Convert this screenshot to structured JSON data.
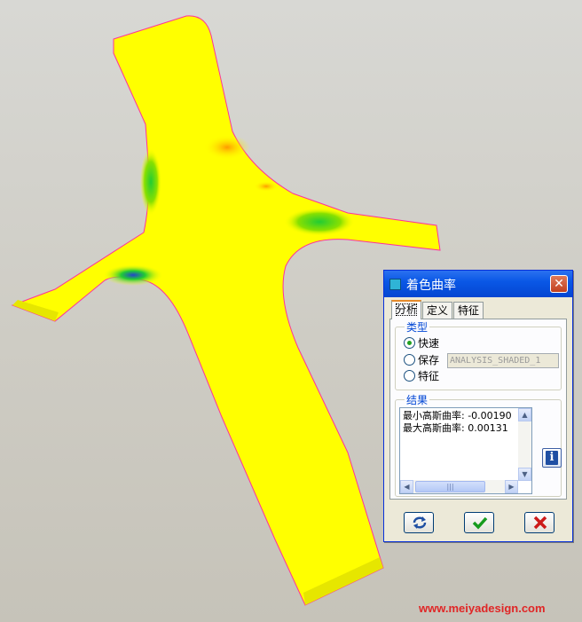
{
  "dialog": {
    "title": "着色曲率",
    "tabs": [
      {
        "label": "分析",
        "active": true
      },
      {
        "label": "定义",
        "active": false
      },
      {
        "label": "特征",
        "active": false
      }
    ],
    "type_group": {
      "label": "类型",
      "options": [
        {
          "label": "快速",
          "checked": true
        },
        {
          "label": "保存",
          "checked": false
        },
        {
          "label": "特征",
          "checked": false
        }
      ],
      "feature_name_value": "ANALYSIS_SHADED_1"
    },
    "result_group": {
      "label": "结果",
      "lines": [
        "最小高斯曲率: -0.00190",
        "最大高斯曲率: 0.00131"
      ]
    }
  },
  "watermark": "www.meiyadesign.com",
  "colors": {
    "surface_base": "#ffff00",
    "surface_gradient_green": "#22cc33",
    "surface_gradient_blue": "#2244cc",
    "surface_gradient_orange": "#ff9900",
    "edge_line": "#ff3399",
    "titlebar": "#0a58e6",
    "watermark": "#e02626"
  },
  "icons": {
    "title": "dialog-icon",
    "close": "close-x-icon",
    "info": "info-icon",
    "regenerate": "recycle-arrows-icon",
    "ok": "checkmark-icon",
    "cancel": "red-x-icon"
  }
}
